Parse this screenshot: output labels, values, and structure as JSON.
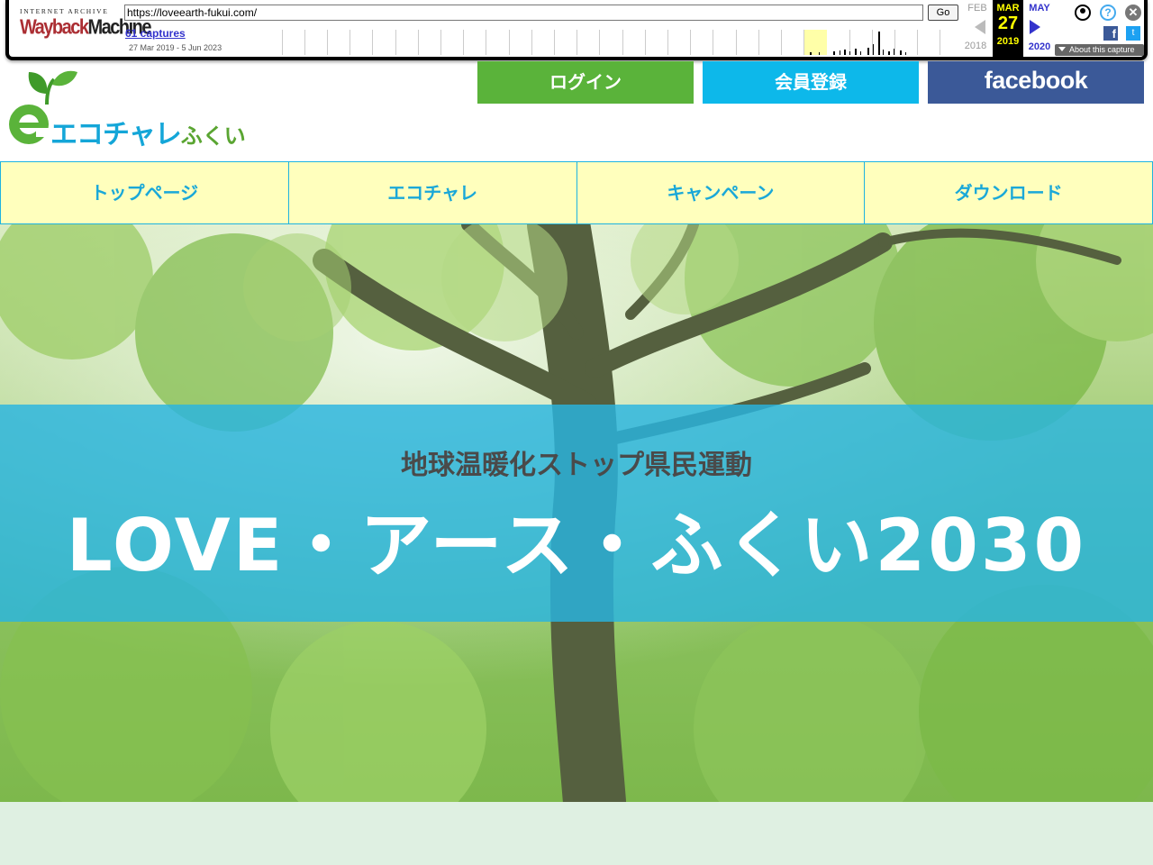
{
  "wayback": {
    "brand_top": "INTERNET ARCHIVE",
    "brand_main_1": "Wayback",
    "brand_main_2": "Machine",
    "url": "https://loveearth-fukui.com/",
    "go_label": "Go",
    "captures": "61 captures",
    "date_range": "27 Mar 2019 - 5 Jun 2023",
    "prev_month": "FEB",
    "prev_year": "2018",
    "current_month": "MAR",
    "current_day": "27",
    "current_year": "2019",
    "next_month": "MAY",
    "next_year": "2020",
    "about": "About this capture",
    "help_symbol": "?",
    "close_symbol": "✕",
    "fb_symbol": "f",
    "tw_symbol": "t",
    "icons": [
      "user-icon",
      "help-icon",
      "close-icon",
      "facebook-icon",
      "twitter-icon"
    ]
  },
  "header": {
    "logo_text": "エコチャレ",
    "logo_text_small": "ふくい",
    "login": "ログイン",
    "register": "会員登録",
    "facebook": "facebook"
  },
  "nav": {
    "items": [
      "トップページ",
      "エコチャレ",
      "キャンペーン",
      "ダウンロード"
    ]
  },
  "hero": {
    "subtitle": "地球温暖化ストップ県民運動",
    "title": "LOVE・アース・ふくい2030"
  },
  "colors": {
    "login": "#5ab33a",
    "register": "#0db8ea",
    "facebook": "#3b5998",
    "nav_bg": "#ffffbd",
    "nav_text": "#1aa8d8",
    "banner": "#28b4e1",
    "footer": "#dff0e2"
  }
}
